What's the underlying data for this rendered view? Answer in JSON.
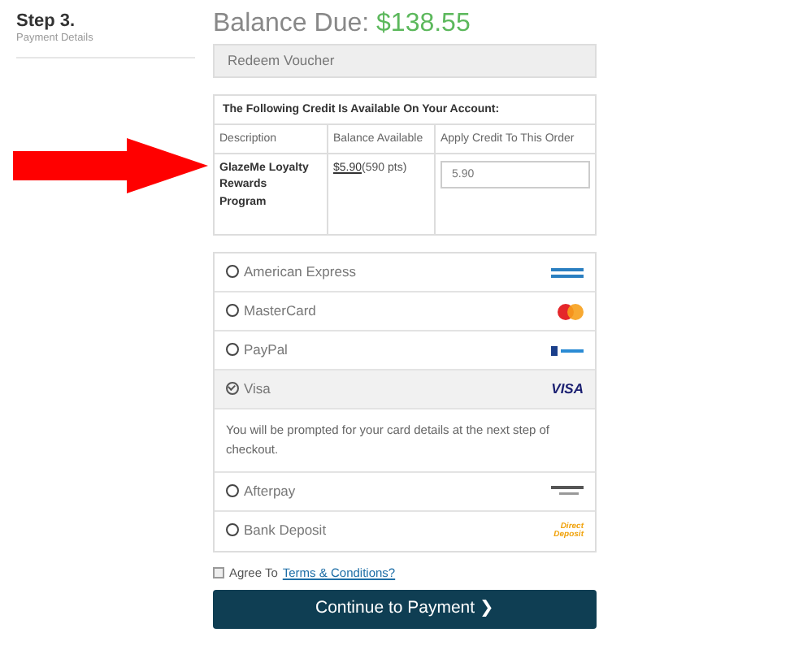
{
  "step": {
    "title": "Step 3.",
    "subtitle": "Payment Details"
  },
  "balance": {
    "label": "Balance Due:",
    "amount": "$138.55"
  },
  "voucher": {
    "label": "Redeem Voucher"
  },
  "credit": {
    "heading": "The Following Credit Is Available On Your Account:",
    "columns": [
      "Description",
      "Balance Available",
      "Apply Credit To This Order"
    ],
    "rows": [
      {
        "description": "GlazeMe Loyalty Rewards Program",
        "balance_link": "$5.90",
        "points": "(590 pts)",
        "apply_value": "5.90"
      }
    ]
  },
  "payment_methods": [
    {
      "label": "American Express",
      "selected": false,
      "kind": "amex"
    },
    {
      "label": "MasterCard",
      "selected": false,
      "kind": "mastercard"
    },
    {
      "label": "PayPal",
      "selected": false,
      "kind": "paypal"
    },
    {
      "label": "Visa",
      "selected": true,
      "kind": "visa",
      "logo_text": "VISA",
      "note": "You will be prompted for your card details at the next step of checkout."
    },
    {
      "label": "Afterpay",
      "selected": false,
      "kind": "afterpay"
    },
    {
      "label": "Bank Deposit",
      "selected": false,
      "kind": "deposit",
      "logo_text": "Direct Deposit"
    }
  ],
  "terms": {
    "checked": false,
    "label": "Agree To",
    "link": "Terms & Conditions?"
  },
  "continue_button": {
    "label": "Continue to Payment",
    "icon": "❯"
  },
  "annotation_arrow": {
    "color": "#ff0000"
  }
}
